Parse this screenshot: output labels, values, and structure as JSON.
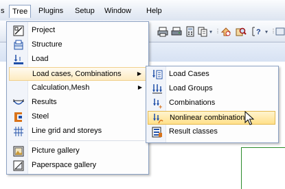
{
  "menubar": {
    "items": [
      "Tree",
      "Plugins",
      "Setup",
      "Window",
      "Help"
    ]
  },
  "toolbar": {
    "icons": [
      "print-icon",
      "printer-setup-icon",
      "calculator-icon",
      "copy-icon",
      "goto-icon",
      "search-icon",
      "help-icon"
    ]
  },
  "tree_menu": {
    "items": [
      {
        "label": "Project",
        "icon": "project-icon"
      },
      {
        "label": "Structure",
        "icon": "structure-icon"
      },
      {
        "label": "Load",
        "icon": "load-icon"
      },
      {
        "label": "Load cases, Combinations",
        "icon": "",
        "has_submenu": true
      },
      {
        "label": "Calculation,Mesh",
        "icon": "",
        "has_submenu": true
      },
      {
        "label": "Results",
        "icon": "results-icon"
      },
      {
        "label": "Steel",
        "icon": "steel-icon"
      },
      {
        "label": "Line grid and storeys",
        "icon": "grid-icon"
      },
      {
        "label": "Picture gallery",
        "icon": "picture-gallery-icon"
      },
      {
        "label": "Paperspace gallery",
        "icon": "paperspace-icon"
      }
    ]
  },
  "submenu": {
    "items": [
      {
        "label": "Load Cases",
        "icon": "load-cases-icon"
      },
      {
        "label": "Load Groups",
        "icon": "load-groups-icon"
      },
      {
        "label": "Combinations",
        "icon": "combinations-icon"
      },
      {
        "label": "Nonlinear combinations",
        "icon": "nonlinear-combinations-icon"
      },
      {
        "label": "Result classes",
        "icon": "result-classes-icon"
      }
    ]
  },
  "colors": {
    "highlight": "#ffe08a",
    "menu_border": "#8aa0c2",
    "accent_blue": "#1f4fa8",
    "accent_orange": "#d9731a"
  }
}
